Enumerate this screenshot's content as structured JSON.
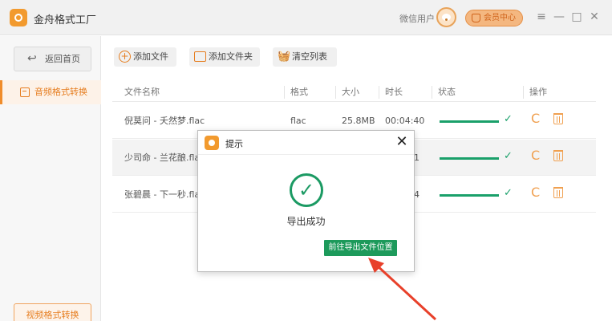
{
  "titlebar": {
    "app_title": "金舟格式工厂",
    "user_label": "微信用户",
    "vip_label": "会员中心",
    "menu_icon": "≡",
    "minimize_icon": "—",
    "maximize_icon": "□",
    "close_icon": "✕"
  },
  "sidebar": {
    "back_label": "返回首页",
    "back_icon": "↩",
    "items": [
      {
        "label": "音频格式转换",
        "active": true
      }
    ],
    "video_label": "视频格式转换"
  },
  "toolbar": {
    "add_file": "添加文件",
    "add_folder": "添加文件夹",
    "clear_list": "清空列表",
    "add_icon": "+",
    "clear_icon": "🧺"
  },
  "table": {
    "columns": [
      "文件名称",
      "格式",
      "大小",
      "时长",
      "状态",
      "操作"
    ],
    "rows": [
      {
        "name": "倪莫问 - 夭然梦.flac",
        "format": "flac",
        "size": "25.8MB",
        "duration": "00:04:40",
        "status_check": "✓",
        "progress": 1.0
      },
      {
        "name": "少司命 - 兰花酿.flac",
        "format": "",
        "size": "",
        "duration": "1",
        "status_check": "✓",
        "progress": 1.0
      },
      {
        "name": "张碧晨 - 下一秒.flac",
        "format": "",
        "size": "",
        "duration": "4",
        "status_check": "✓",
        "progress": 1.0
      }
    ],
    "refresh_icon": "C"
  },
  "dialog": {
    "title": "提示",
    "close_icon": "✕",
    "success_icon": "✓",
    "message": "导出成功",
    "button_label": "前往导出文件位置"
  },
  "colors": {
    "accent_orange": "#f08c2a",
    "success_green": "#1aa06a",
    "button_green": "#1d9a5b",
    "arrow_red": "#e8402a"
  }
}
